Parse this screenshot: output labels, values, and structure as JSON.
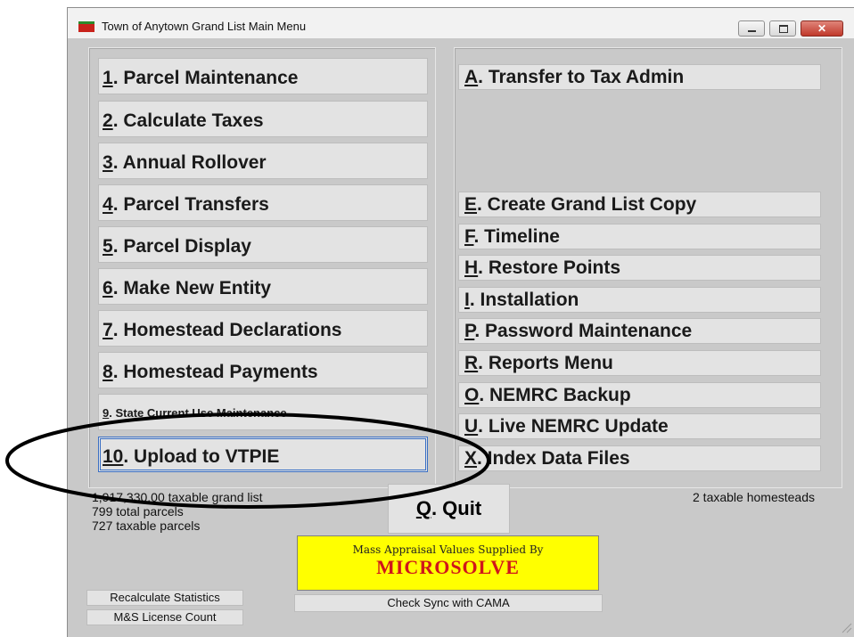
{
  "window": {
    "title": "Town of Anytown Grand List Main Menu"
  },
  "left_menu": [
    {
      "key": "1",
      "rest": ".  Parcel Maintenance"
    },
    {
      "key": "2",
      "rest": ".  Calculate Taxes"
    },
    {
      "key": "3",
      "rest": ".  Annual Rollover"
    },
    {
      "key": "4",
      "rest": ".  Parcel Transfers"
    },
    {
      "key": "5",
      "rest": ".  Parcel Display"
    },
    {
      "key": "6",
      "rest": ". Make New Entity"
    },
    {
      "key": "7",
      "rest": ". Homestead Declarations"
    },
    {
      "key": "8",
      "rest": ". Homestead Payments"
    },
    {
      "key": "9",
      "rest": ". State Current Use Maintenance"
    },
    {
      "key": "10",
      "rest": ". Upload to VTPIE"
    }
  ],
  "right_menu": [
    {
      "key": "A",
      "rest": ". Transfer to Tax Admin"
    },
    {
      "key": "E",
      "rest": ". Create Grand List Copy"
    },
    {
      "key": "F",
      "rest": ". Timeline"
    },
    {
      "key": "H",
      "rest": ". Restore Points"
    },
    {
      "key": "I",
      "rest": ".  Installation"
    },
    {
      "key": "P",
      "rest": ".  Password Maintenance"
    },
    {
      "key": "R",
      "rest": ".  Reports Menu"
    },
    {
      "key": "O",
      "rest": ". NEMRC Backup"
    },
    {
      "key": "U",
      "rest": ". Live NEMRC Update"
    },
    {
      "key": "X",
      "rest": ". Index Data Files"
    }
  ],
  "stats": {
    "grand_list": "1,917,330.00 taxable grand list",
    "total_parcels": "799 total parcels",
    "taxable_parcels": "727 taxable parcels",
    "homesteads": "2 taxable homesteads"
  },
  "quit": {
    "key": "Q",
    "rest": ".  Quit"
  },
  "banner": {
    "line1": "Mass Appraisal Values Supplied By",
    "line2": "MICROSOLVE"
  },
  "bottom_buttons": {
    "recalc": "Recalculate Statistics",
    "license": "M&S License Count",
    "sync": "Check Sync with CAMA"
  },
  "colors": {
    "banner_bg": "#ffff00",
    "banner_text": "#d0161b",
    "window_bg": "#c9c9c9"
  }
}
